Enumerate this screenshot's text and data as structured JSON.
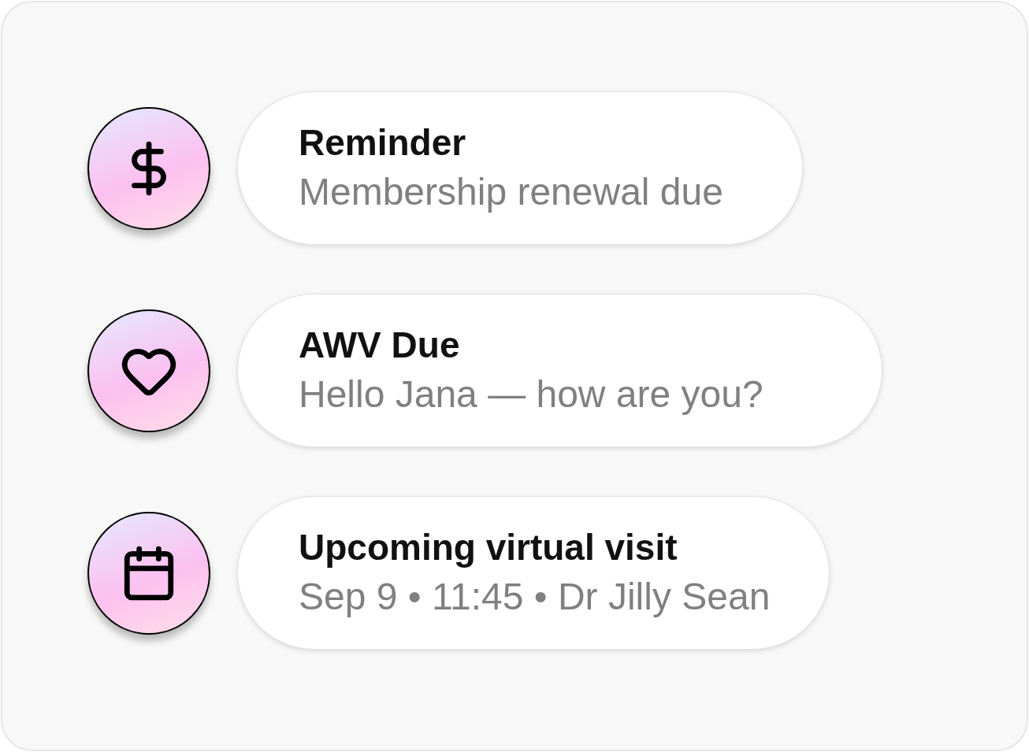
{
  "notifications": [
    {
      "title": "Reminder",
      "subtitle": "Membership renewal due"
    },
    {
      "title": "AWV Due",
      "subtitle": "Hello Jana — how are you?"
    },
    {
      "title": "Upcoming virtual visit",
      "subtitle": "Sep 9 • 11:45 • Dr Jilly Sean"
    }
  ]
}
